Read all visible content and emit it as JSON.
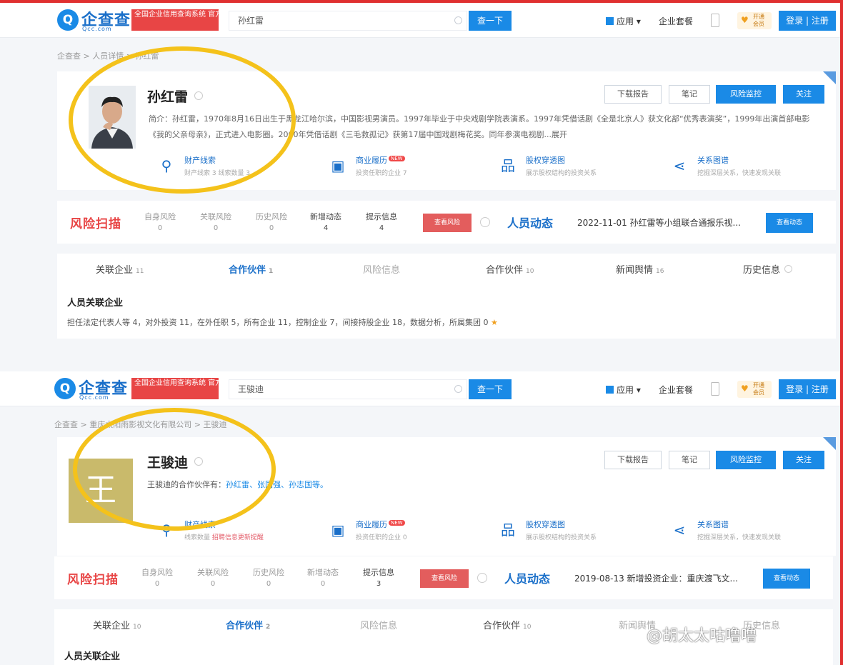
{
  "shots": [
    {
      "logo": {
        "mark": "Q",
        "name": "企查查",
        "sub": "Qcc.com",
        "slogan": "全国企业信用查询系统 官方备案企业征信机构"
      },
      "search": {
        "value": "孙红雷",
        "button": "查一下"
      },
      "nav": {
        "app": "应用",
        "package": "企业套餐",
        "vip": "开通会员",
        "login": "登录 | 注册"
      },
      "breadcrumb": "企查查 > 人员详情 > 孙红雷",
      "profile": {
        "name": "孙红雷",
        "intro": "简介：孙红雷，1970年8月16日出生于黑龙江哈尔滨，中国影视男演员。1997年毕业于中央戏剧学院表演系。1997年凭借话剧《全是北京人》获文化部“优秀表演奖”，1999年出演首部电影《我的父亲母亲》，正式进入电影圈。2000年凭借话剧《三毛救孤记》获第17届中国戏剧梅花奖。同年参演电视剧...展开",
        "partners_label": "",
        "partners": [],
        "buttons": {
          "download": "下载报告",
          "note": "笔记",
          "monitor": "风险监控",
          "follow": "关注"
        },
        "cells": [
          {
            "icon": "link-icon",
            "title": "财产线索",
            "hot": "",
            "sub": "财产线索 3  线索数量 3"
          },
          {
            "icon": "briefcase-icon",
            "title": "商业履历",
            "hot": "NEW",
            "sub": "投资任职的企业 7"
          },
          {
            "icon": "org-chart-icon",
            "title": "股权穿透图",
            "hot": "",
            "sub": "展示股权结构的投资关系"
          },
          {
            "icon": "share-icon",
            "title": "关系图谱",
            "hot": "",
            "sub": "挖掘深层关系，快速发现关联"
          }
        ]
      },
      "risk": {
        "logo": "风险扫描",
        "stats": [
          {
            "label": "自身风险",
            "value": "0"
          },
          {
            "label": "关联风险",
            "value": "0"
          },
          {
            "label": "历史风险",
            "value": "0"
          },
          {
            "label": "新增动态",
            "value": "4"
          },
          {
            "label": "提示信息",
            "value": "4"
          }
        ],
        "button": "查看风险",
        "dynamic_logo": "人员动态",
        "dynamic_text": "2022-11-01 孙红雷等小组联合通报乐视...",
        "dynamic_button": "查看动态"
      },
      "tabs": [
        {
          "label": "关联企业",
          "count": "11"
        },
        {
          "label": "合作伙伴",
          "count": "1"
        },
        {
          "label": "风险信息",
          "count": ""
        },
        {
          "label": "合作伙伴",
          "count": "10"
        },
        {
          "label": "新闻舆情",
          "count": "16"
        },
        {
          "label": "历史信息",
          "count": ""
        }
      ],
      "section_title": "人员关联企业",
      "section_links": "担任法定代表人等 4，对外投资 11，在外任职 5，所有企业 11，控制企业 7，间接持股企业 18，数据分析，所属集团 0",
      "section_star": "★"
    },
    {
      "logo": {
        "mark": "Q",
        "name": "企查查",
        "sub": "Qcc.com",
        "slogan": "全国企业信用查询系统 官方备案企业征信机构"
      },
      "search": {
        "value": "王骏迪",
        "button": "查一下"
      },
      "nav": {
        "app": "应用",
        "package": "企业套餐",
        "vip": "开通会员",
        "login": "登录 | 注册"
      },
      "breadcrumb": "企查查 > 重庆太阳雨影视文化有限公司 > 王骏迪",
      "profile": {
        "name": "王骏迪",
        "avatar_char": "王",
        "intro": "",
        "partners_label": "王骏迪的合作伙伴有：",
        "partners": [
          "孙红雷",
          "、张国强",
          "、孙志国等。"
        ],
        "buttons": {
          "download": "下载报告",
          "note": "笔记",
          "monitor": "风险监控",
          "follow": "关注"
        },
        "cells": [
          {
            "icon": "link-icon",
            "title": "财产线索",
            "hot": "",
            "sub": "线索数量 ",
            "sub_alert": "招聘信息更新提醒"
          },
          {
            "icon": "briefcase-icon",
            "title": "商业履历",
            "hot": "NEW",
            "sub": "投资任职的企业 0"
          },
          {
            "icon": "org-chart-icon",
            "title": "股权穿透图",
            "hot": "",
            "sub": "展示股权结构的投资关系"
          },
          {
            "icon": "share-icon",
            "title": "关系图谱",
            "hot": "",
            "sub": "挖掘深层关系，快速发现关联"
          }
        ]
      },
      "risk": {
        "logo": "风险扫描",
        "stats": [
          {
            "label": "自身风险",
            "value": "0"
          },
          {
            "label": "关联风险",
            "value": "0"
          },
          {
            "label": "历史风险",
            "value": "0"
          },
          {
            "label": "新增动态",
            "value": "0"
          },
          {
            "label": "提示信息",
            "value": "3"
          }
        ],
        "button": "查看风险",
        "dynamic_logo": "人员动态",
        "dynamic_text": "2019-08-13 新增投资企业：重庆渡飞文...",
        "dynamic_button": "查看动态"
      },
      "tabs": [
        {
          "label": "关联企业",
          "count": "10"
        },
        {
          "label": "合作伙伴",
          "count": "2"
        },
        {
          "label": "风险信息",
          "count": ""
        },
        {
          "label": "合作伙伴",
          "count": "10"
        },
        {
          "label": "新闻舆情",
          "count": ""
        },
        {
          "label": "历史信息",
          "count": ""
        }
      ],
      "section_title": "人员关联企业",
      "section_links": "",
      "section_star": ""
    }
  ],
  "watermark": "@胡太太咕噜噜",
  "colors": {
    "brand": "#1a8ae6",
    "risk": "#e84545",
    "highlight_ring": "#f4c21b",
    "frame": "#e03030"
  }
}
